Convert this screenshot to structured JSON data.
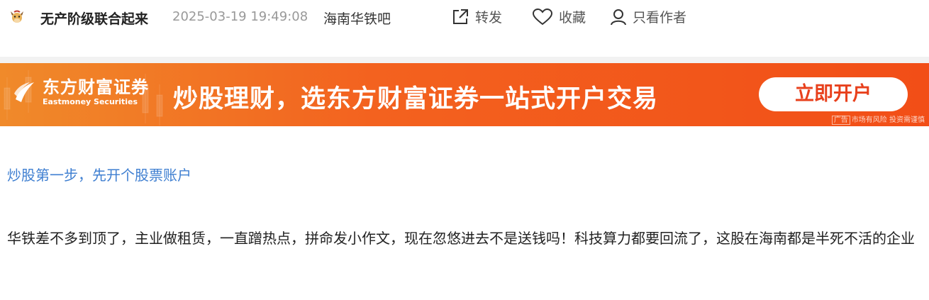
{
  "post": {
    "author_name": "无产阶级联合起来",
    "timestamp": "2025-03-19 19:49:08",
    "forum_name": "海南华铁吧",
    "avatar_icon": "cartoon-cow-avatar"
  },
  "actions": {
    "share_label": "转发",
    "favorite_label": "收藏",
    "author_only_label": "只看作者"
  },
  "ad": {
    "brand_cn": "东方财富证券",
    "brand_en": "Eastmoney Securities",
    "slogan": "炒股理财，选东方财富证券一站式开户交易",
    "cta_label": "立即开户",
    "ad_tag": "广告",
    "risk_note": "市场有风险 投资需谨慎",
    "accent_color": "#f24e17"
  },
  "content": {
    "promo_link": "炒股第一步，先开个股票账户",
    "text": "华铁差不多到顶了，主业做租赁，一直蹭热点，拼命发小作文，现在忽悠进去不是送钱吗！科技算力都要回流了，这股在海南都是半死不活的企业"
  }
}
